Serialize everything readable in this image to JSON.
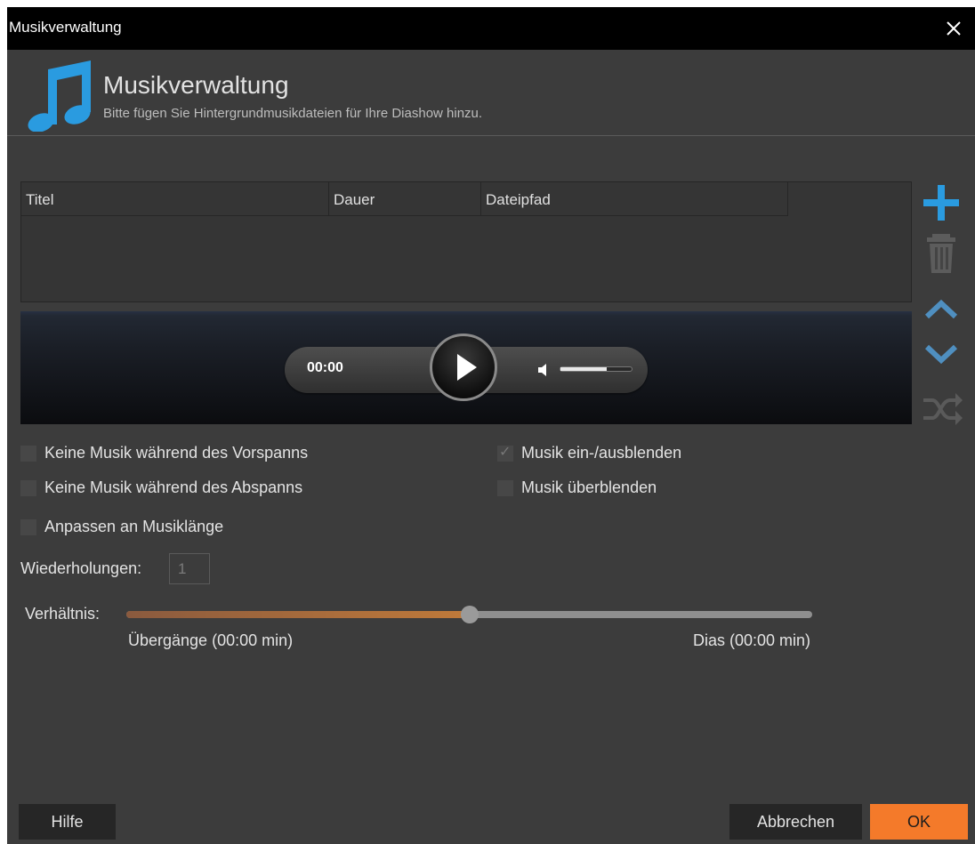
{
  "window": {
    "title": "Musikverwaltung",
    "close_icon": "close-icon"
  },
  "header": {
    "icon": "music-note-icon",
    "title": "Musikverwaltung",
    "subtitle": "Bitte fügen Sie Hintergrundmusikdateien für Ihre Diashow hinzu.",
    "accent_color": "#2a9be0"
  },
  "table": {
    "columns": [
      "Titel",
      "Dauer",
      "Dateipfad"
    ],
    "rows": []
  },
  "side_toolbar": {
    "icons": [
      "plus-icon",
      "trash-icon",
      "chevron-up-icon",
      "chevron-down-icon",
      "shuffle-icon"
    ]
  },
  "player": {
    "time": "00:00",
    "volume_fraction": 0.65
  },
  "options": {
    "no_music_intro": {
      "label": "Keine Musik während des Vorspanns",
      "checked": false
    },
    "no_music_outro": {
      "label": "Keine Musik während des Abspanns",
      "checked": false
    },
    "fit_to_music": {
      "label": "Anpassen an Musiklänge",
      "checked": false
    },
    "fade_in_out": {
      "label": "Musik ein-/ausblenden",
      "checked": true
    },
    "crossfade": {
      "label": "Musik überblenden",
      "checked": false
    }
  },
  "repetitions": {
    "label": "Wiederholungen:",
    "value": "1"
  },
  "ratio": {
    "label": "Verhältnis:",
    "value_fraction": 0.5,
    "left_label": "Übergänge (00:00 min)",
    "right_label": "Dias (00:00 min)"
  },
  "buttons": {
    "help": "Hilfe",
    "cancel": "Abbrechen",
    "ok": "OK",
    "ok_color": "#f47a2a"
  }
}
